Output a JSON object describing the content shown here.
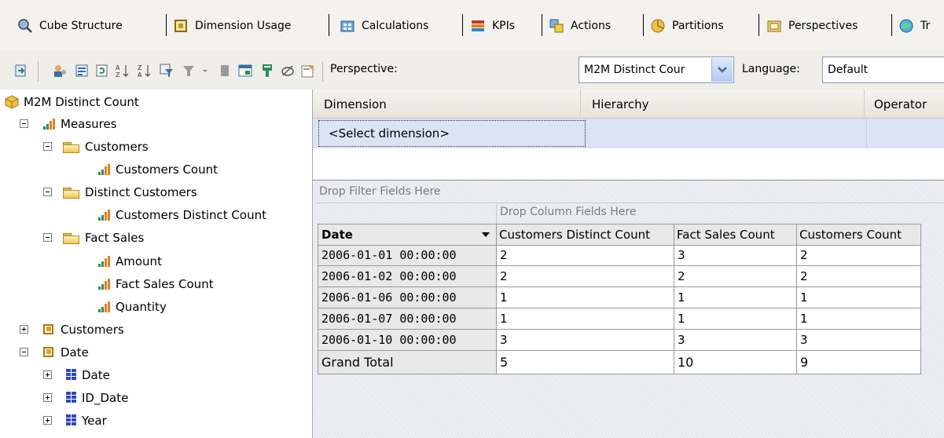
{
  "tabs": [
    {
      "label": "Cube Structure",
      "icon": "cube-structure-icon"
    },
    {
      "label": "Dimension Usage",
      "icon": "dimension-usage-icon"
    },
    {
      "label": "Calculations",
      "icon": "calculations-icon"
    },
    {
      "label": "KPIs",
      "icon": "kpis-icon"
    },
    {
      "label": "Actions",
      "icon": "actions-icon"
    },
    {
      "label": "Partitions",
      "icon": "partitions-icon"
    },
    {
      "label": "Perspectives",
      "icon": "perspectives-icon"
    },
    {
      "label": "Tr",
      "icon": "translations-icon"
    }
  ],
  "toolbar": {
    "perspective_label": "Perspective:",
    "perspective_value": "M2M Distinct Cour",
    "language_label": "Language:",
    "language_value": "Default"
  },
  "tree": {
    "root": "M2M Distinct Count",
    "measures": "Measures",
    "customers_group": "Customers",
    "customers_count": "Customers Count",
    "distinct_customers_group": "Distinct Customers",
    "customers_distinct_count": "Customers Distinct Count",
    "fact_sales_group": "Fact Sales",
    "amount": "Amount",
    "fact_sales_count": "Fact Sales Count",
    "quantity": "Quantity",
    "customers_dim": "Customers",
    "date_dim": "Date",
    "date_hier": "Date",
    "id_date_hier": "ID_Date",
    "year_hier": "Year"
  },
  "filter": {
    "col_dimension": "Dimension",
    "col_hierarchy": "Hierarchy",
    "col_operator": "Operator",
    "select_dimension": "<Select dimension>"
  },
  "pivot": {
    "drop_filter": "Drop Filter Fields Here",
    "drop_column": "Drop Column Fields Here",
    "row_header": "Date",
    "columns": [
      "Customers Distinct Count",
      "Fact Sales Count",
      "Customers Count"
    ],
    "rows": [
      {
        "date": "2006-01-01 00:00:00",
        "values": [
          "2",
          "3",
          "2"
        ]
      },
      {
        "date": "2006-01-02 00:00:00",
        "values": [
          "2",
          "2",
          "2"
        ]
      },
      {
        "date": "2006-01-06 00:00:00",
        "values": [
          "1",
          "1",
          "1"
        ]
      },
      {
        "date": "2006-01-07 00:00:00",
        "values": [
          "1",
          "1",
          "1"
        ]
      },
      {
        "date": "2006-01-10 00:00:00",
        "values": [
          "3",
          "3",
          "3"
        ]
      }
    ],
    "grand_total": {
      "label": "Grand Total",
      "values": [
        "5",
        "10",
        "9"
      ]
    }
  }
}
